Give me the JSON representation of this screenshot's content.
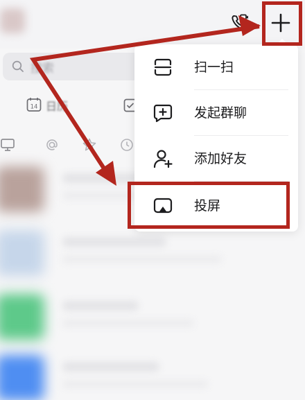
{
  "background_app": {
    "search_placeholder": "搜索",
    "calendar_label": "日历",
    "calendar_day": "14"
  },
  "popup_menu": {
    "items": [
      {
        "label": "扫一扫",
        "icon": "scan-icon"
      },
      {
        "label": "发起群聊",
        "icon": "group-chat-icon"
      },
      {
        "label": "添加好友",
        "icon": "add-friend-icon"
      },
      {
        "label": "投屏",
        "icon": "screen-cast-icon"
      }
    ]
  },
  "colors": {
    "annotation_red": "#b3261e",
    "menu_bg": "#ffffff",
    "text_primary": "#1c1c1e"
  }
}
